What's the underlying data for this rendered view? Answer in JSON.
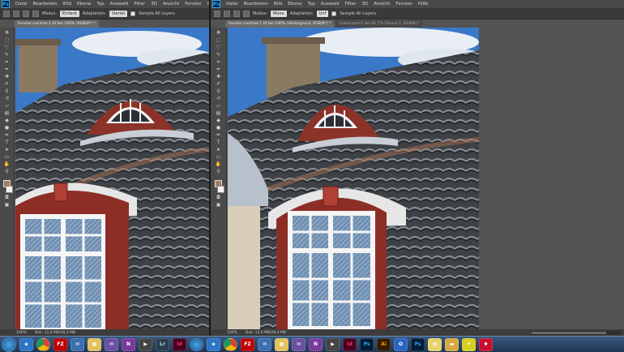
{
  "app": {
    "logo_text": "Ps"
  },
  "menu": [
    "Datei",
    "Bearbeiten",
    "Bild",
    "Ebene",
    "Typ",
    "Auswahl",
    "Filter",
    "3D",
    "Ansicht",
    "Fenster",
    "Hilfe"
  ],
  "left": {
    "options": {
      "mode_label": "Modus:",
      "mode_value": "Einfarb",
      "adapt_label": "Adaptation:",
      "adapt_value": "Viertel",
      "sample_label": "Sample All Layers"
    },
    "tabs": [
      {
        "label": "Fenster-nachher.1.tif bei 100% (RGB/8*) *"
      }
    ],
    "status": {
      "zoom": "100%",
      "doc": "Dok: 12,0 MB/26,4 MB"
    }
  },
  "right": {
    "options": {
      "mode_label": "Modus:",
      "mode_value": "Mono",
      "adapt_label": "Adaptation:",
      "adapt_value": "Unf",
      "sample_label": "Sample All Layers"
    },
    "tabs": [
      {
        "label": "Fenster-nachher.1.tif bei 100% (Hintergrund, RGB/8*) *"
      },
      {
        "label": "Unbenannt-1 bei 66,7% (Ebene 1, RGB/8) *"
      }
    ],
    "status": {
      "zoom": "100%",
      "doc": "Dok: 12,0 MB/26,4 MB"
    }
  },
  "taskbar": [
    "start",
    "ie",
    "chrome",
    "filezilla",
    "thunderbird",
    "explorer",
    "mail",
    "onenote",
    "lightroom",
    "indesign",
    "photoshop",
    "illustrator",
    "outlook",
    "messenger",
    "folder",
    "run",
    "acrobat"
  ],
  "taskbar_labels": {
    "lr": "Lr",
    "id": "Id",
    "ps": "Ps",
    "ai": "Ai",
    "fz": "FZ"
  },
  "colors": {
    "fg_swatch": "#a57c60",
    "bg_swatch": "#f2f2f2",
    "taskbar": "#2a4566"
  }
}
